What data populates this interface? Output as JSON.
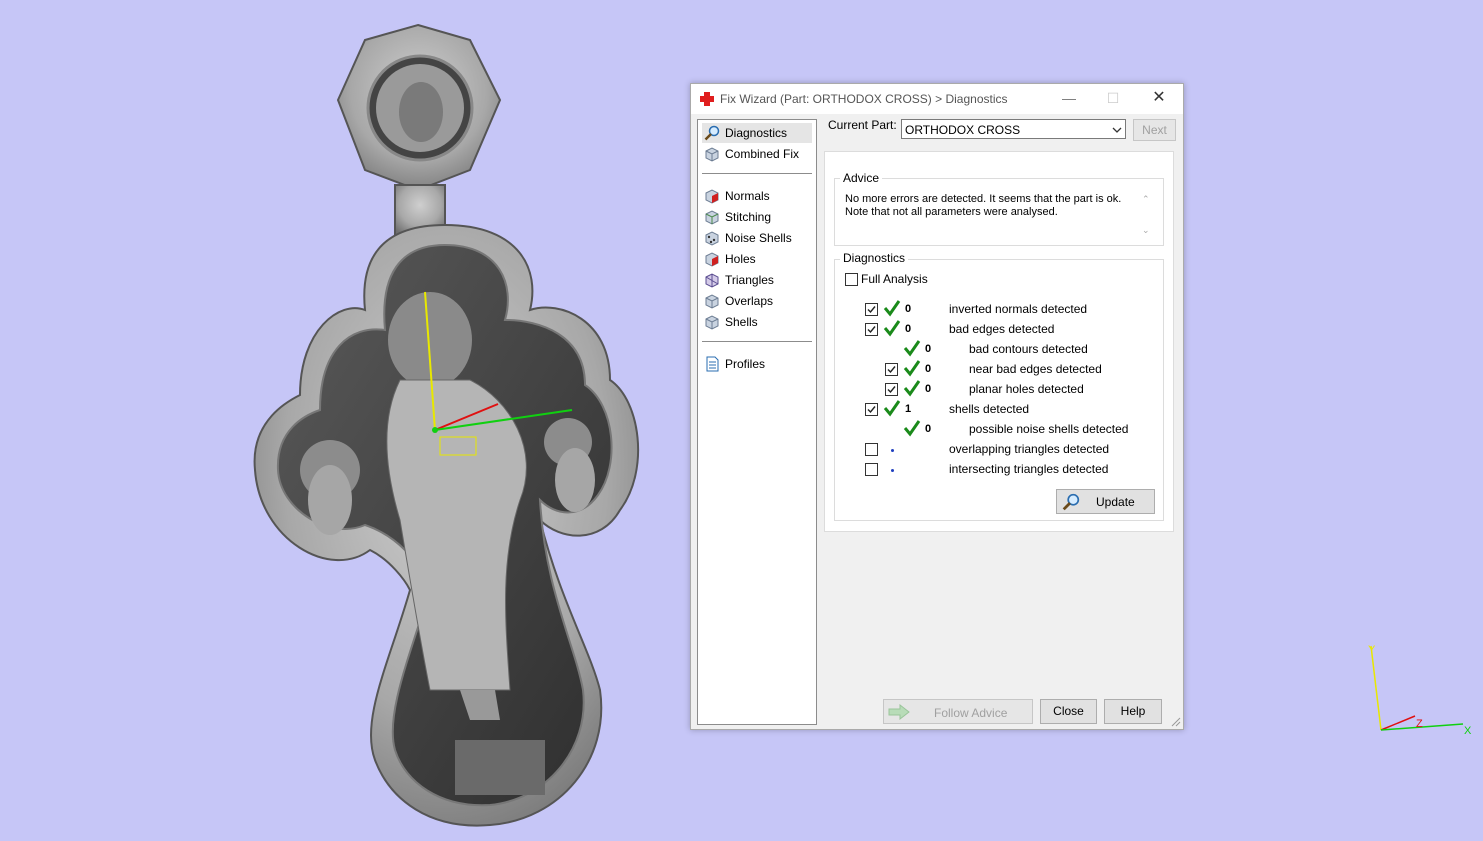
{
  "dialog": {
    "title": "Fix Wizard (Part: ORTHODOX CROSS) > Diagnostics",
    "controls": {
      "minimize": "—",
      "maximize": "☐",
      "close": "✕"
    }
  },
  "nav": {
    "items": [
      {
        "label": "Diagnostics",
        "icon": "magnifier-icon",
        "selected": true
      },
      {
        "label": "Combined Fix",
        "icon": "cube-icon"
      },
      {
        "label": "Normals",
        "icon": "normals-cube-icon"
      },
      {
        "label": "Stitching",
        "icon": "stitching-cube-icon"
      },
      {
        "label": "Noise Shells",
        "icon": "noise-shells-icon"
      },
      {
        "label": "Holes",
        "icon": "holes-cube-icon"
      },
      {
        "label": "Triangles",
        "icon": "triangles-cube-icon"
      },
      {
        "label": "Overlaps",
        "icon": "overlaps-cube-icon"
      },
      {
        "label": "Shells",
        "icon": "shells-cube-icon"
      },
      {
        "label": "Profiles",
        "icon": "document-icon"
      }
    ]
  },
  "current_part": {
    "label": "Current Part:",
    "value": "ORTHODOX CROSS",
    "next_label": "Next"
  },
  "advice": {
    "title": "Advice",
    "line1": "No more errors are detected. It seems that the part is ok.",
    "line2": "Note that not all parameters were analysed."
  },
  "diagnostics": {
    "title": "Diagnostics",
    "full_analysis_label": "Full Analysis",
    "rows": [
      {
        "checked": true,
        "status": "ok",
        "count": "0",
        "label": "inverted normals detected",
        "indent": 0
      },
      {
        "checked": true,
        "status": "ok",
        "count": "0",
        "label": "bad edges detected",
        "indent": 0
      },
      {
        "checked": null,
        "status": "ok",
        "count": "0",
        "label": "bad contours detected",
        "indent": 1
      },
      {
        "checked": true,
        "status": "ok",
        "count": "0",
        "label": "near bad edges detected",
        "indent": 1
      },
      {
        "checked": true,
        "status": "ok",
        "count": "0",
        "label": "planar holes detected",
        "indent": 1
      },
      {
        "checked": true,
        "status": "ok",
        "count": "1",
        "label": "shells detected",
        "indent": 0
      },
      {
        "checked": null,
        "status": "ok",
        "count": "0",
        "label": "possible noise shells detected",
        "indent": 1
      },
      {
        "checked": false,
        "status": "unknown",
        "count": "",
        "label": "overlapping triangles detected",
        "indent": 0
      },
      {
        "checked": false,
        "status": "unknown",
        "count": "",
        "label": "intersecting triangles detected",
        "indent": 0
      }
    ],
    "update_label": "Update"
  },
  "footer": {
    "follow_advice": "Follow Advice",
    "close": "Close",
    "help": "Help"
  },
  "viewport": {
    "model_name": "ORTHODOX CROSS",
    "axes": {
      "x": "X",
      "y": "Y",
      "z": "Z"
    },
    "background_color": "#c6c6f7"
  }
}
